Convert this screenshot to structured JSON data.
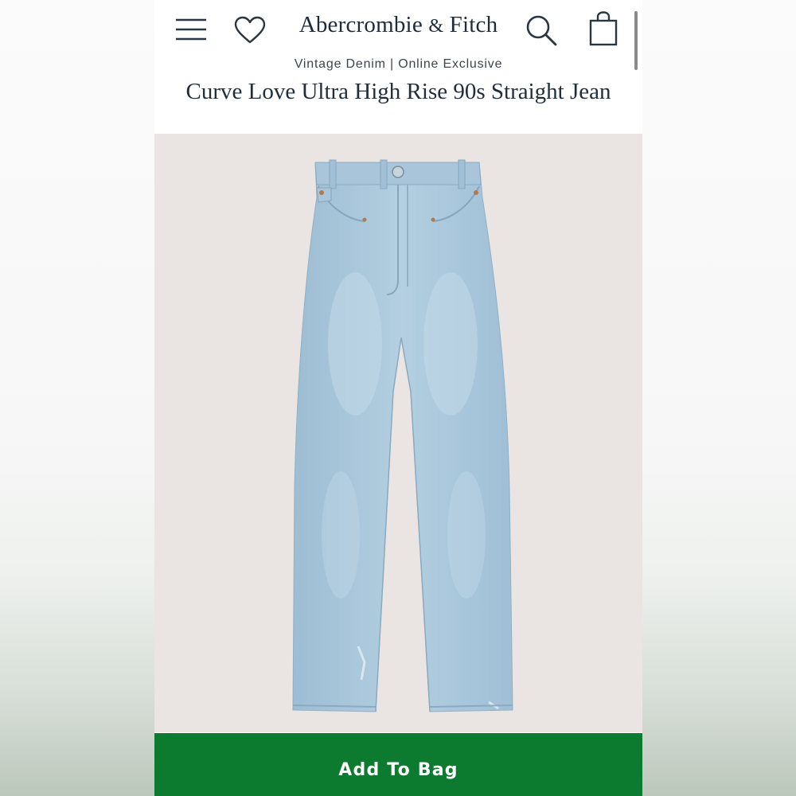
{
  "header": {
    "brand_name": "Abercrombie",
    "brand_amp": "&",
    "brand_suffix": "Fitch",
    "icons": [
      "menu-icon",
      "heart-icon",
      "search-icon",
      "bag-icon"
    ]
  },
  "product": {
    "subtitle": "Vintage Denim | Online Exclusive",
    "title": "Curve Love Ultra High Rise 90s Straight Jean",
    "image": "light-wash-straight-jeans"
  },
  "actions": {
    "add_to_bag_label": "Add To Bag"
  },
  "colors": {
    "accent_green": "#0c7a2f",
    "brand_navy": "#1d2b3a",
    "image_bg": "#eae5e3",
    "denim": "#a9c6db"
  }
}
